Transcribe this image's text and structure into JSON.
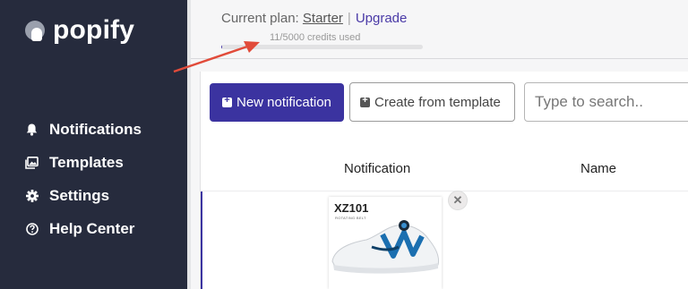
{
  "brand": {
    "name": "popify"
  },
  "sidebar": {
    "items": [
      {
        "label": "Notifications",
        "icon": "bell-icon"
      },
      {
        "label": "Templates",
        "icon": "image-gallery-icon"
      },
      {
        "label": "Settings",
        "icon": "gear-icon"
      },
      {
        "label": "Help Center",
        "icon": "question-circle-icon"
      }
    ]
  },
  "header": {
    "plan_prefix": "Current plan:",
    "plan_name": "Starter",
    "separator": "|",
    "upgrade_label": "Upgrade",
    "credits_text": "11/5000 credits used",
    "credits_used": 11,
    "credits_total": 5000
  },
  "toolbar": {
    "new_label": "New notification",
    "template_label": "Create from template",
    "search_placeholder": "Type to search.."
  },
  "table": {
    "columns": [
      "Notification",
      "Name"
    ],
    "rows": [
      {
        "product_code": "XZ101",
        "product_subtitle": "ROTATING BELT"
      }
    ]
  },
  "colors": {
    "sidebar_bg": "#262b3d",
    "primary": "#3b33a0",
    "arrow": "#e14b3a"
  }
}
